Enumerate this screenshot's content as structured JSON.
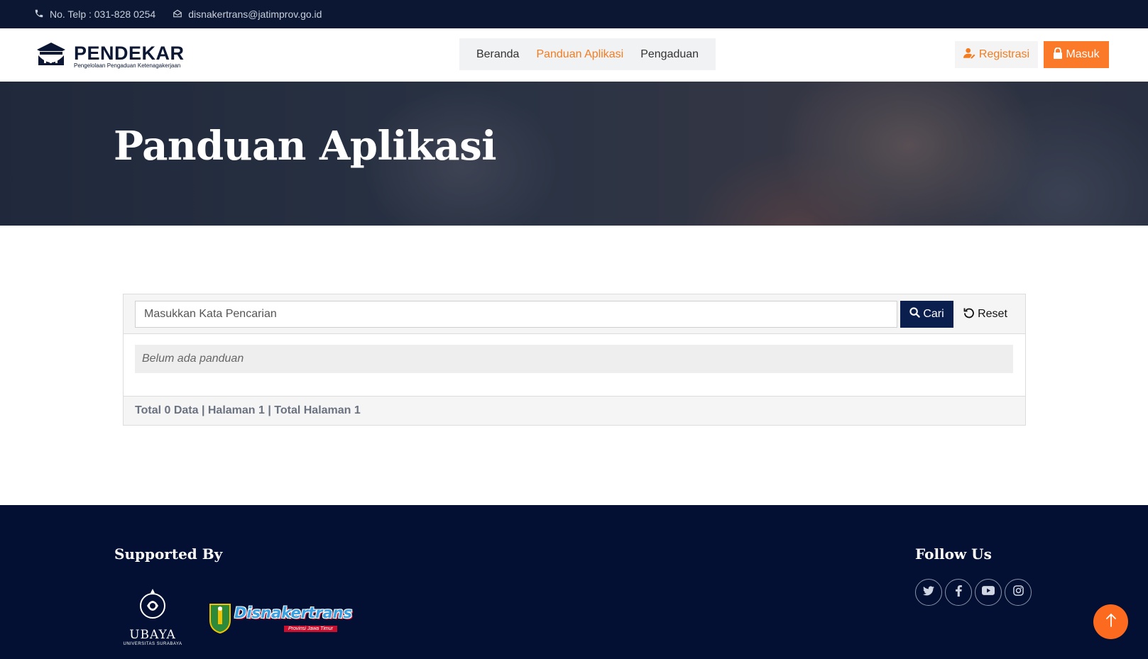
{
  "topbar": {
    "phone": "No. Telp : 031-828 0254",
    "email": "disnakertrans@jatimprov.go.id"
  },
  "brand": {
    "title": "PENDEKAR",
    "subtitle": "Pengelolaan Pengaduan Ketenagakerjaan"
  },
  "nav": {
    "items": [
      {
        "label": "Beranda",
        "active": false
      },
      {
        "label": "Panduan Aplikasi",
        "active": true
      },
      {
        "label": "Pengaduan",
        "active": false
      }
    ]
  },
  "auth": {
    "register_label": "Registrasi",
    "login_label": "Masuk"
  },
  "hero": {
    "title": "Panduan Aplikasi"
  },
  "search": {
    "placeholder": "Masukkan Kata Pencarian",
    "value": "",
    "search_label": "Cari",
    "reset_label": "Reset"
  },
  "results": {
    "empty_message": "Belum ada panduan",
    "summary": "Total 0 Data | Halaman 1 | Total Halaman 1"
  },
  "footer": {
    "supported_title": "Supported By",
    "follow_title": "Follow Us",
    "sponsors": [
      {
        "name": "UBAYA",
        "sub": "UNIVERSITAS SURABAYA"
      },
      {
        "name": "Disnakertrans",
        "sub": "Provinsi Jawa Timur"
      }
    ],
    "socials": [
      "twitter-icon",
      "facebook-icon",
      "youtube-icon",
      "instagram-icon"
    ]
  },
  "colors": {
    "navy": "#0b1733",
    "footer": "#031033",
    "accent": "#fb7a2a",
    "search_button": "#0b1f4f"
  }
}
